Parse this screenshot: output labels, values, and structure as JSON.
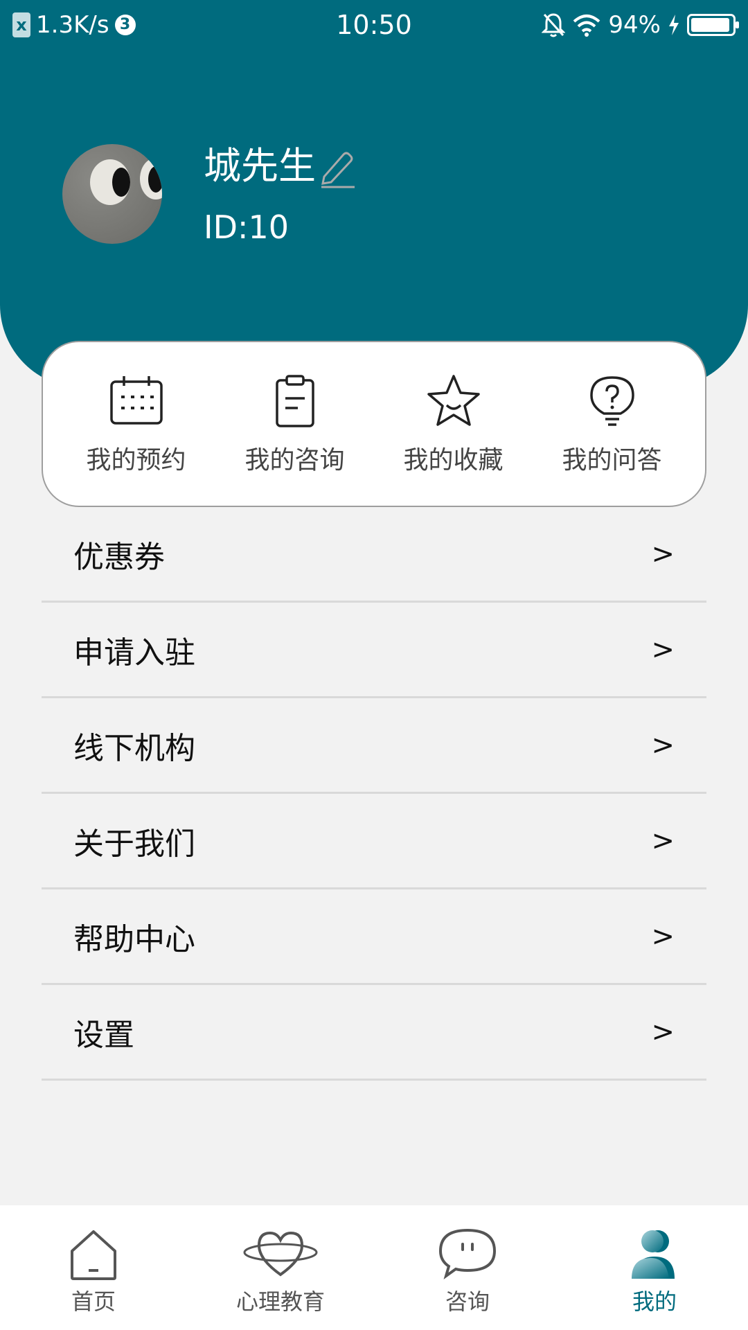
{
  "status_bar": {
    "net_speed": "1.3K/s",
    "notif_count": "3",
    "time": "10:50",
    "battery_percent": "94%",
    "battery_level": 0.94
  },
  "profile": {
    "username": "城先生",
    "user_id": "ID:10"
  },
  "quick_actions": [
    {
      "label": "我的预约",
      "icon": "calendar-icon"
    },
    {
      "label": "我的咨询",
      "icon": "clipboard-icon"
    },
    {
      "label": "我的收藏",
      "icon": "star-icon"
    },
    {
      "label": "我的问答",
      "icon": "question-bulb-icon"
    }
  ],
  "menu": [
    {
      "label": "优惠券",
      "arrow": ">"
    },
    {
      "label": "申请入驻",
      "arrow": ">"
    },
    {
      "label": "线下机构",
      "arrow": ">"
    },
    {
      "label": "关于我们",
      "arrow": ">"
    },
    {
      "label": "帮助中心",
      "arrow": ">"
    },
    {
      "label": "设置",
      "arrow": ">"
    }
  ],
  "bottom_nav": [
    {
      "label": "首页",
      "icon": "home-icon",
      "active": false
    },
    {
      "label": "心理教育",
      "icon": "heart-icon",
      "active": false
    },
    {
      "label": "咨询",
      "icon": "chat-bubble-icon",
      "active": false
    },
    {
      "label": "我的",
      "icon": "user-icon",
      "active": true
    }
  ],
  "colors": {
    "accent": "#006b7e",
    "background": "#f2f2f2"
  }
}
